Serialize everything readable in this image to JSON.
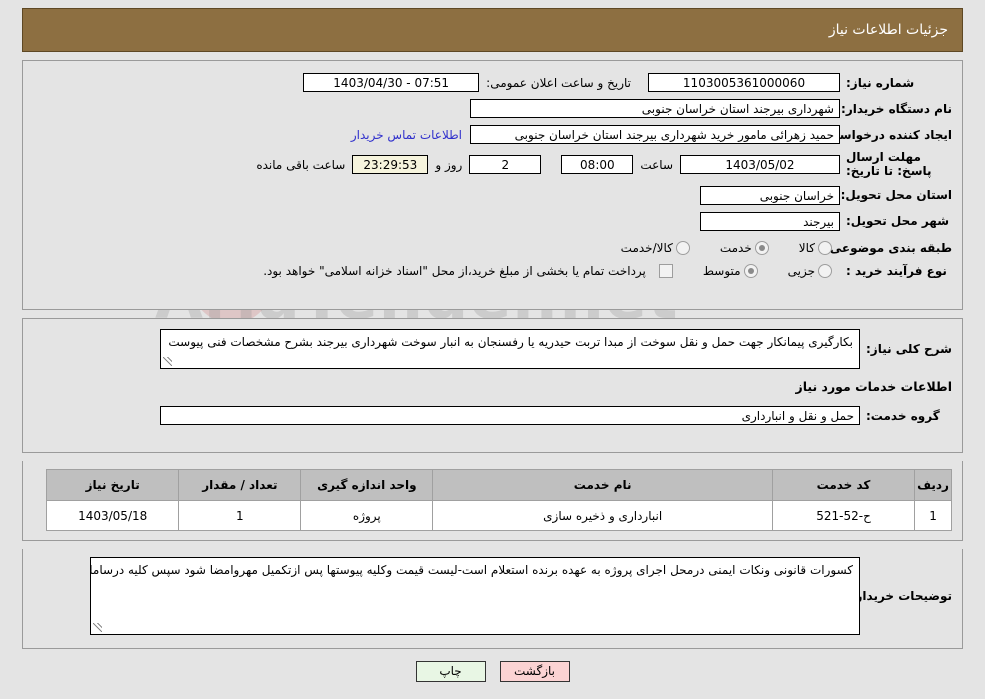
{
  "header": {
    "title": "جزئیات اطلاعات نیاز"
  },
  "watermark": {
    "text": "AriaTender.net"
  },
  "form": {
    "need_number_label": "شماره نیاز:",
    "need_number_value": "1103005361000060",
    "announce_label": "تاریخ و ساعت اعلان عمومی:",
    "announce_value": "07:51 - 1403/04/30",
    "buyer_org_label": "نام دستگاه خریدار:",
    "buyer_org_value": "شهرداری بیرجند استان خراسان جنوبی",
    "creator_label": "ایجاد کننده درخواست:",
    "creator_value": "حمید زهرائی مامور خرید شهرداری بیرجند استان خراسان جنوبی",
    "contact_link": "اطلاعات تماس خریدار",
    "deadline_label": "مهلت ارسال پاسخ: تا تاریخ:",
    "deadline_date": "1403/05/02",
    "hour_label": "ساعت",
    "deadline_time": "08:00",
    "days_value": "2",
    "days_label": "روز و",
    "countdown_value": "23:29:53",
    "countdown_label": "ساعت باقی مانده",
    "province_label": "استان محل تحویل:",
    "province_value": "خراسان جنوبی",
    "city_label": "شهر محل تحویل:",
    "city_value": "بیرجند",
    "category_label": "طبقه بندی موضوعی:",
    "category_options": [
      {
        "label": "کالا",
        "selected": false
      },
      {
        "label": "خدمت",
        "selected": true
      },
      {
        "label": "کالا/خدمت",
        "selected": false
      }
    ],
    "process_label": "نوع فرآیند خرید :",
    "process_options": [
      {
        "label": "جزیی",
        "selected": false
      },
      {
        "label": "متوسط",
        "selected": true
      }
    ],
    "treasury_note": "پرداخت تمام یا بخشی از مبلغ خرید،از محل \"اسناد خزانه اسلامی\" خواهد بود."
  },
  "description": {
    "label": "شرح کلی نیاز:",
    "value": "بکارگیری پیمانکار جهت حمل و نقل سوخت از مبدا تربت حیدریه یا رفسنجان به انبار سوخت شهرداری بیرجند بشرح مشخصات فنی پیوست"
  },
  "services": {
    "section_title": "اطلاعات خدمات مورد نیاز",
    "group_label": "گروه خدمت:",
    "group_value": "حمل و نقل و انبارداری",
    "columns": [
      "ردیف",
      "کد خدمت",
      "نام خدمت",
      "واحد اندازه گیری",
      "تعداد / مقدار",
      "تاریخ نیاز"
    ],
    "rows": [
      {
        "radif": "1",
        "code": "ح-52-521",
        "name": "انبارداری و ذخیره سازی",
        "unit": "پروژه",
        "qty": "1",
        "date": "1403/05/18"
      }
    ]
  },
  "notes": {
    "label": "توضیحات خریدار:",
    "value": "کسورات قانونی ونکات ایمنی درمحل اجرای پروژه به عهده برنده استعلام است-لیست قیمت وکلیه پیوستها پس ازتکمیل مهروامضا شود سپس کلیه درسامانه بارگذاری شود"
  },
  "footer": {
    "print_label": "چاپ",
    "return_label": "بازگشت"
  },
  "colors": {
    "header_bg": "#8d6f41",
    "page_bg": "#e4e4e4",
    "table_header_bg": "#bfbfbf",
    "link": "#3030cc",
    "countdown_bg": "#f6f4dd",
    "print_btn": "#e8f6e4",
    "return_btn": "#fbd3d3"
  }
}
